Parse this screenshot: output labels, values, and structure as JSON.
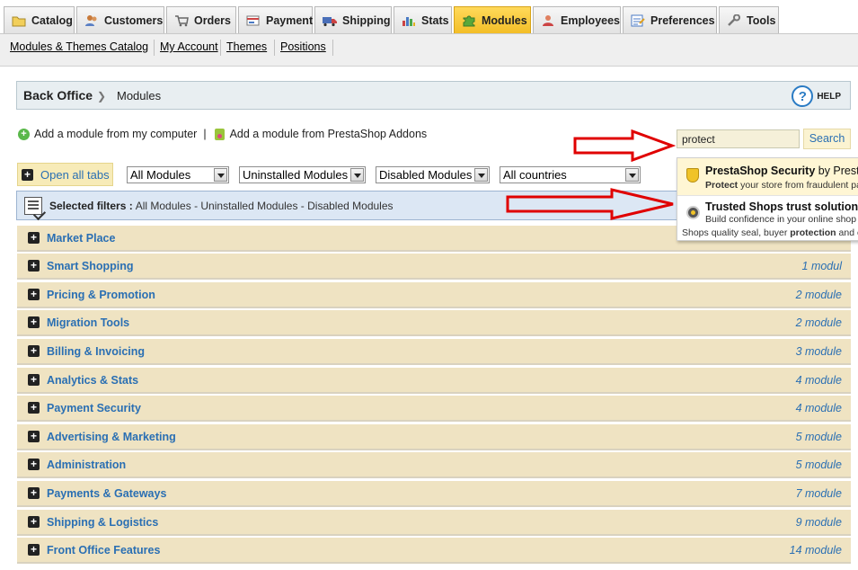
{
  "tabs": [
    {
      "label": "Catalog",
      "icon": "folder-icon",
      "active": false
    },
    {
      "label": "Customers",
      "icon": "customers-icon",
      "active": false
    },
    {
      "label": "Orders",
      "icon": "cart-icon",
      "active": false
    },
    {
      "label": "Payment",
      "icon": "payment-icon",
      "active": false
    },
    {
      "label": "Shipping",
      "icon": "truck-icon",
      "active": false
    },
    {
      "label": "Stats",
      "icon": "chart-icon",
      "active": false
    },
    {
      "label": "Modules",
      "icon": "puzzle-icon",
      "active": true
    },
    {
      "label": "Employees",
      "icon": "employee-icon",
      "active": false
    },
    {
      "label": "Preferences",
      "icon": "preferences-icon",
      "active": false
    },
    {
      "label": "Tools",
      "icon": "wrench-icon",
      "active": false
    }
  ],
  "submenu": [
    "Modules & Themes Catalog",
    "My Account",
    "Themes",
    "Positions"
  ],
  "breadcrumb": {
    "root": "Back Office",
    "current": "Modules",
    "help": "HELP"
  },
  "add_module": {
    "from_computer": "Add a module from my computer",
    "separator": "|",
    "from_addons": "Add a module from PrestaShop Addons"
  },
  "search": {
    "value": "protect",
    "button": "Search"
  },
  "filters": {
    "open_all": "Open all tabs",
    "category": "All Modules",
    "install_status": "Uninstalled Modules",
    "enabled_status": "Disabled Modules",
    "country": "All countries"
  },
  "selected_filters": {
    "label": "Selected filters :",
    "value": "All Modules - Uninstalled Modules - Disabled Modules"
  },
  "categories": [
    {
      "name": "Market Place",
      "count": ""
    },
    {
      "name": "Smart Shopping",
      "count": "1 modul"
    },
    {
      "name": "Pricing & Promotion",
      "count": "2 module"
    },
    {
      "name": "Migration Tools",
      "count": "2 module"
    },
    {
      "name": "Billing & Invoicing",
      "count": "3 module"
    },
    {
      "name": "Analytics & Stats",
      "count": "4 module"
    },
    {
      "name": "Payment Security",
      "count": "4 module"
    },
    {
      "name": "Advertising & Marketing",
      "count": "5 module"
    },
    {
      "name": "Administration",
      "count": "5 module"
    },
    {
      "name": "Payments & Gateways",
      "count": "7 module"
    },
    {
      "name": "Shipping & Logistics",
      "count": "9 module"
    },
    {
      "name": "Front Office Features",
      "count": "14 module"
    }
  ],
  "autocomplete": [
    {
      "title": "PrestaShop Security",
      "by": "by Presta",
      "desc_bold": "Protect",
      "desc_rest": " your store from fraudulent pa"
    },
    {
      "title": "Trusted Shops trust solutions",
      "desc_line1": "Build confidence in your online shop",
      "desc_line2_pre": "Shops quality seal, buyer ",
      "desc_line2_bold": "protection",
      "desc_line2_post": " and c"
    }
  ],
  "colors": {
    "accent_blue": "#2a6fb3",
    "active_tab": "#f3be27",
    "arrow_red": "#e00000"
  }
}
